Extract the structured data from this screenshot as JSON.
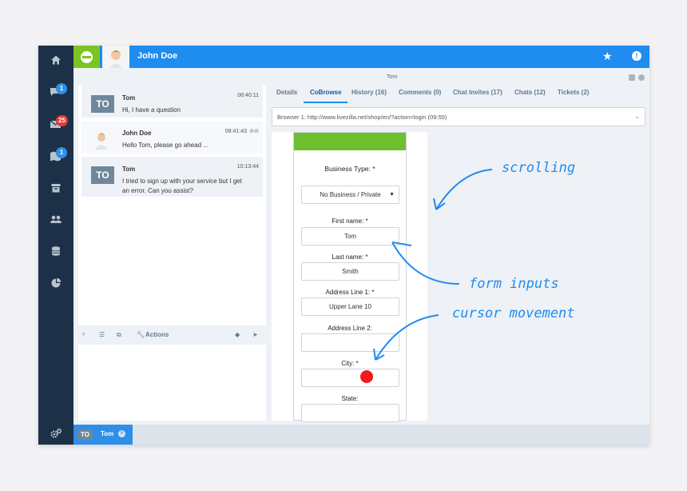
{
  "top": {
    "name": "John Doe"
  },
  "sidebar": {
    "badges": [
      "1",
      "25",
      "1"
    ]
  },
  "messages": [
    {
      "avatar": "TO",
      "name": "Tom",
      "time": "08:40:11",
      "text": "Hi, I have a question"
    },
    {
      "avatar": "photo",
      "name": "John Doe",
      "time": "08:41:43",
      "text": "Hello Tom, please go ahead ..."
    },
    {
      "avatar": "TO",
      "name": "Tom",
      "time": "10:13:44",
      "text": "I tried to sign up with your service but I get an error. Can you assist?"
    }
  ],
  "composer": {
    "actions_label": "Actions"
  },
  "panel": {
    "title": "Tom",
    "tabs": [
      "Details",
      "CoBrowse",
      "History (16)",
      "Comments (0)",
      "Chat Invites (17)",
      "Chats (12)",
      "Tickets (2)"
    ],
    "url": "Browser 1: http://www.livezilla.net/shop/en/?action=login (09:55)"
  },
  "form": {
    "business_type_label": "Business Type: *",
    "business_type_value": "No Business / Private",
    "first_name_label": "First name: *",
    "first_name_value": "Tom",
    "last_name_label": "Last name: *",
    "last_name_value": "Smith",
    "address1_label": "Address Line 1: *",
    "address1_value": "Upper Lane 10",
    "address2_label": "Address Line 2:",
    "city_label": "City: *",
    "state_label": "State:"
  },
  "annotations": {
    "scrolling": "scrolling",
    "form_inputs": "form inputs",
    "cursor_movement": "cursor movement"
  },
  "bottom": {
    "avatar": "TO",
    "name": "Tom"
  },
  "colors": {
    "primary": "#1f8cf0",
    "sidebar": "#1c3147",
    "logo": "#7cc423",
    "cursor": "#f21b1b"
  }
}
